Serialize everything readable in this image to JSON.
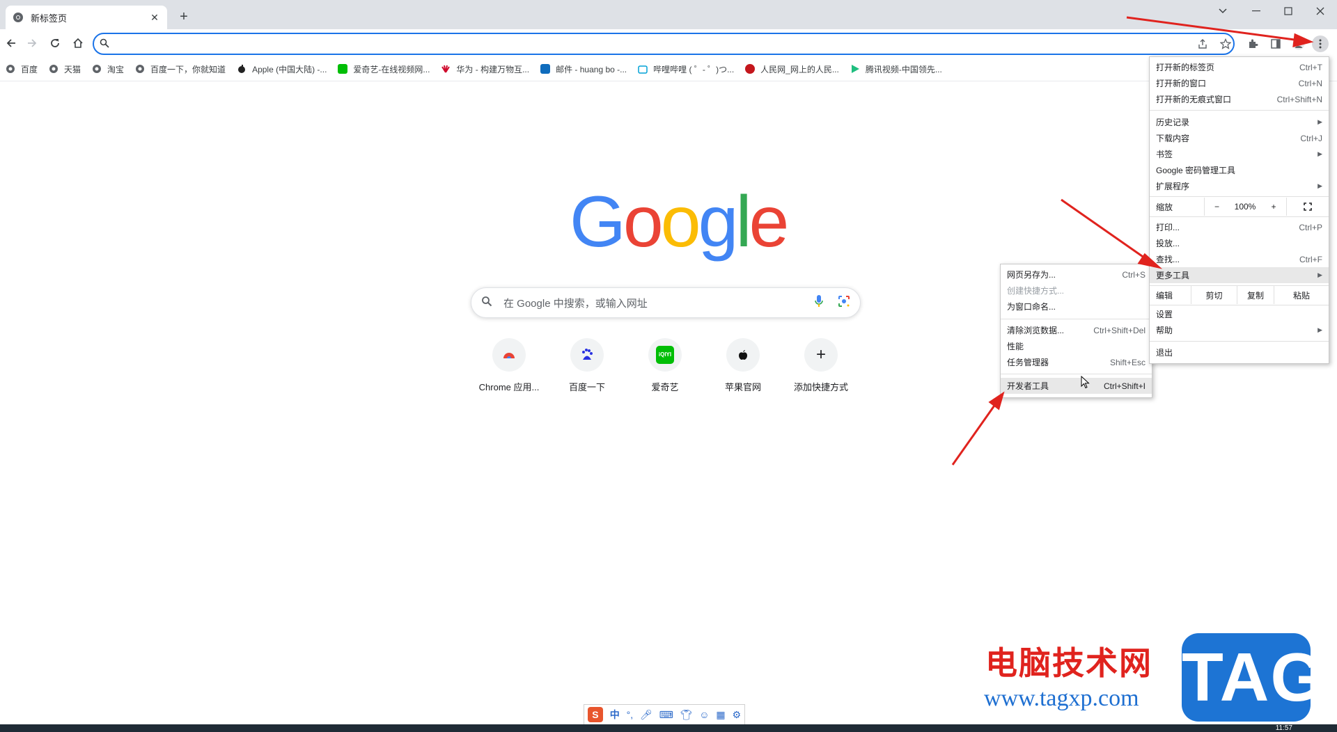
{
  "tab": {
    "title": "新标签页"
  },
  "omnibox": {
    "value": ""
  },
  "bookmarks": [
    {
      "label": "百度",
      "color": "#5f6368"
    },
    {
      "label": "天猫",
      "color": "#5f6368"
    },
    {
      "label": "淘宝",
      "color": "#5f6368"
    },
    {
      "label": "百度一下，你就知道",
      "color": "#5f6368"
    },
    {
      "label": "Apple (中国大陆) -...",
      "color": "#222222"
    },
    {
      "label": "爱奇艺-在线视频网...",
      "color": "#00be06"
    },
    {
      "label": "华为 - 构建万物互...",
      "color": "#cf0a2c"
    },
    {
      "label": "邮件 - huang bo -...",
      "color": "#0f6cbd"
    },
    {
      "label": "哔哩哔哩 ( ゜- ゜)つ...",
      "color": "#00a1d6"
    },
    {
      "label": "人民网_网上的人民...",
      "color": "#c4161c"
    },
    {
      "label": "腾讯视频-中国领先...",
      "color": "#1fbe7f"
    }
  ],
  "ntp": {
    "search_placeholder": "在 Google 中搜索，或输入网址",
    "shortcuts": [
      {
        "label": "Chrome 应用...",
        "icon": "chrome-webstore-icon"
      },
      {
        "label": "百度一下",
        "icon": "baidu-icon"
      },
      {
        "label": "爱奇艺",
        "icon": "iqiyi-icon",
        "badge": "iQIYI"
      },
      {
        "label": "苹果官网",
        "icon": "apple-icon"
      },
      {
        "label": "添加快捷方式",
        "icon": "plus-icon",
        "badge": "+"
      }
    ]
  },
  "main_menu": {
    "new_tab": {
      "label": "打开新的标签页",
      "shortcut": "Ctrl+T"
    },
    "new_window": {
      "label": "打开新的窗口",
      "shortcut": "Ctrl+N"
    },
    "new_incognito": {
      "label": "打开新的无痕式窗口",
      "shortcut": "Ctrl+Shift+N"
    },
    "history": {
      "label": "历史记录"
    },
    "downloads": {
      "label": "下载内容",
      "shortcut": "Ctrl+J"
    },
    "bookmarks": {
      "label": "书签"
    },
    "passwords": {
      "label": "Google 密码管理工具"
    },
    "extensions": {
      "label": "扩展程序"
    },
    "zoom": {
      "label": "缩放",
      "minus": "−",
      "value": "100%",
      "plus": "+"
    },
    "print": {
      "label": "打印...",
      "shortcut": "Ctrl+P"
    },
    "cast": {
      "label": "投放..."
    },
    "find": {
      "label": "查找...",
      "shortcut": "Ctrl+F"
    },
    "more_tools": {
      "label": "更多工具"
    },
    "edit": {
      "label": "编辑",
      "cut": "剪切",
      "copy": "复制",
      "paste": "粘贴"
    },
    "settings": {
      "label": "设置"
    },
    "help": {
      "label": "帮助"
    },
    "exit": {
      "label": "退出"
    }
  },
  "more_tools_menu": {
    "save_as": {
      "label": "网页另存为...",
      "shortcut": "Ctrl+S"
    },
    "create_shortcut": {
      "label": "创建快捷方式..."
    },
    "name_window": {
      "label": "为窗口命名..."
    },
    "clear_data": {
      "label": "清除浏览数据...",
      "shortcut": "Ctrl+Shift+Del"
    },
    "performance": {
      "label": "性能"
    },
    "task_manager": {
      "label": "任务管理器",
      "shortcut": "Shift+Esc"
    },
    "dev_tools": {
      "label": "开发者工具",
      "shortcut": "Ctrl+Shift+I"
    }
  },
  "watermark": {
    "title": "电脑技术网",
    "url": "www.tagxp.com",
    "tag": "TAG"
  },
  "ime": {
    "mode": "中"
  },
  "taskbar": {
    "clock": "11:57"
  },
  "colors": {
    "accent": "#1a73e8",
    "annotation_arrow": "#e0231e"
  }
}
